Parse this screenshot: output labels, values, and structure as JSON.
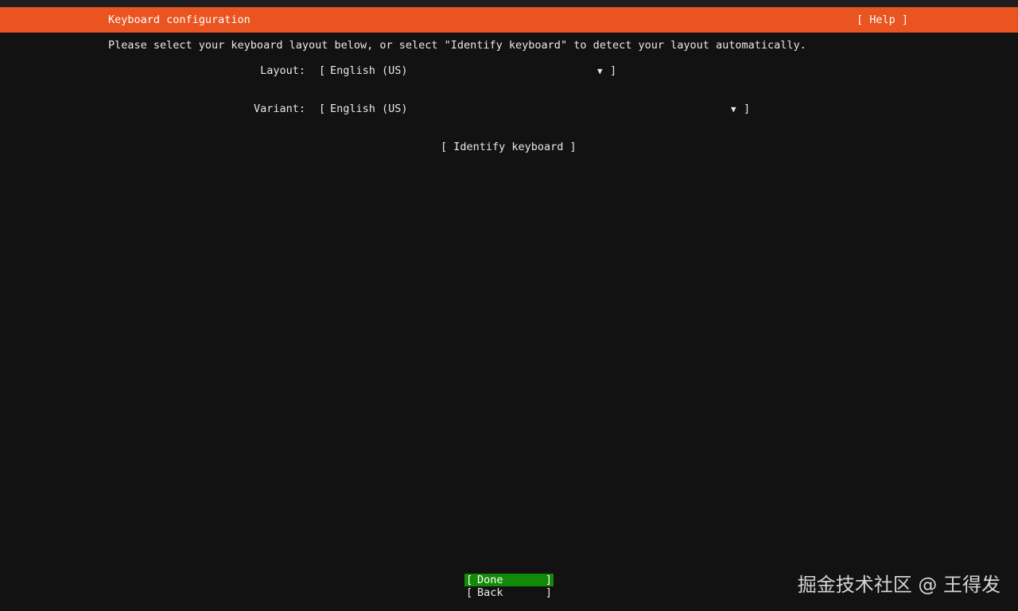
{
  "header": {
    "title": "Keyboard configuration",
    "help_label": "[ Help ]",
    "accent_color": "#e95420"
  },
  "intro_text": "Please select your keyboard layout below, or select \"Identify keyboard\" to detect your layout automatically.",
  "layout": {
    "label": "Layout:",
    "value": "English (US)",
    "open_bracket": "[",
    "close_bracket": "]",
    "arrow": "▼"
  },
  "variant": {
    "label": "Variant:",
    "value": "English (US)",
    "open_bracket": "[",
    "close_bracket": "]",
    "arrow": "▼"
  },
  "identify_label": "[ Identify keyboard ]",
  "buttons": {
    "open_bracket": "[",
    "close_bracket": "]",
    "done_label": "Done",
    "back_label": "Back",
    "done_color": "#138a07"
  },
  "watermark": "掘金技术社区 @ 王得发"
}
